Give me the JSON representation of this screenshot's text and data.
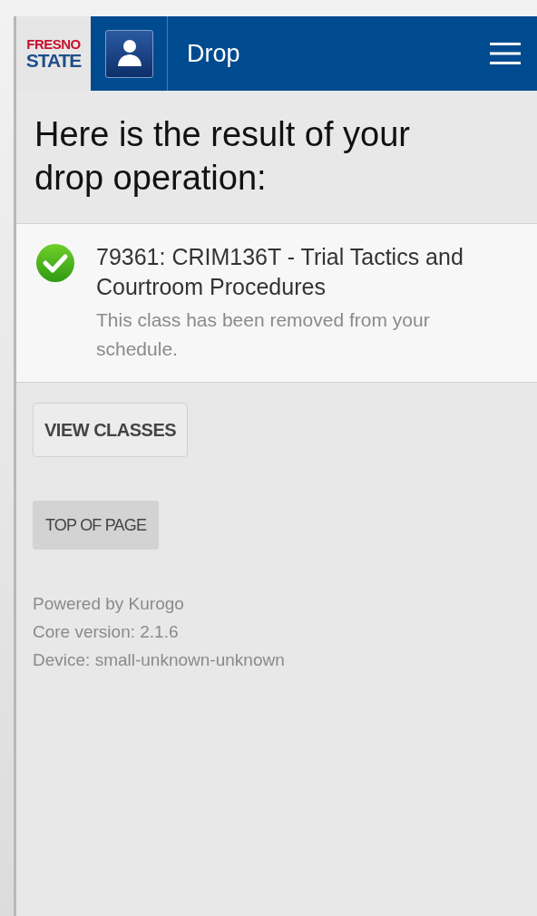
{
  "header": {
    "logo": {
      "line_1": "FRESNO",
      "line_2": "STATE"
    },
    "title": "Drop"
  },
  "heading": "Here is the result of your drop operation:",
  "results": [
    {
      "kind": "success",
      "title": "79361: CRIM136T - Trial Tactics and Courtroom Procedures",
      "message": "This class has been removed from your schedule."
    }
  ],
  "buttons": {
    "view_classes": "VIEW CLASSES",
    "top_of_page": "TOP OF PAGE"
  },
  "footer": [
    "Powered by Kurogo",
    "Core version: 2.1.6",
    "Device: small-unknown-unknown"
  ]
}
